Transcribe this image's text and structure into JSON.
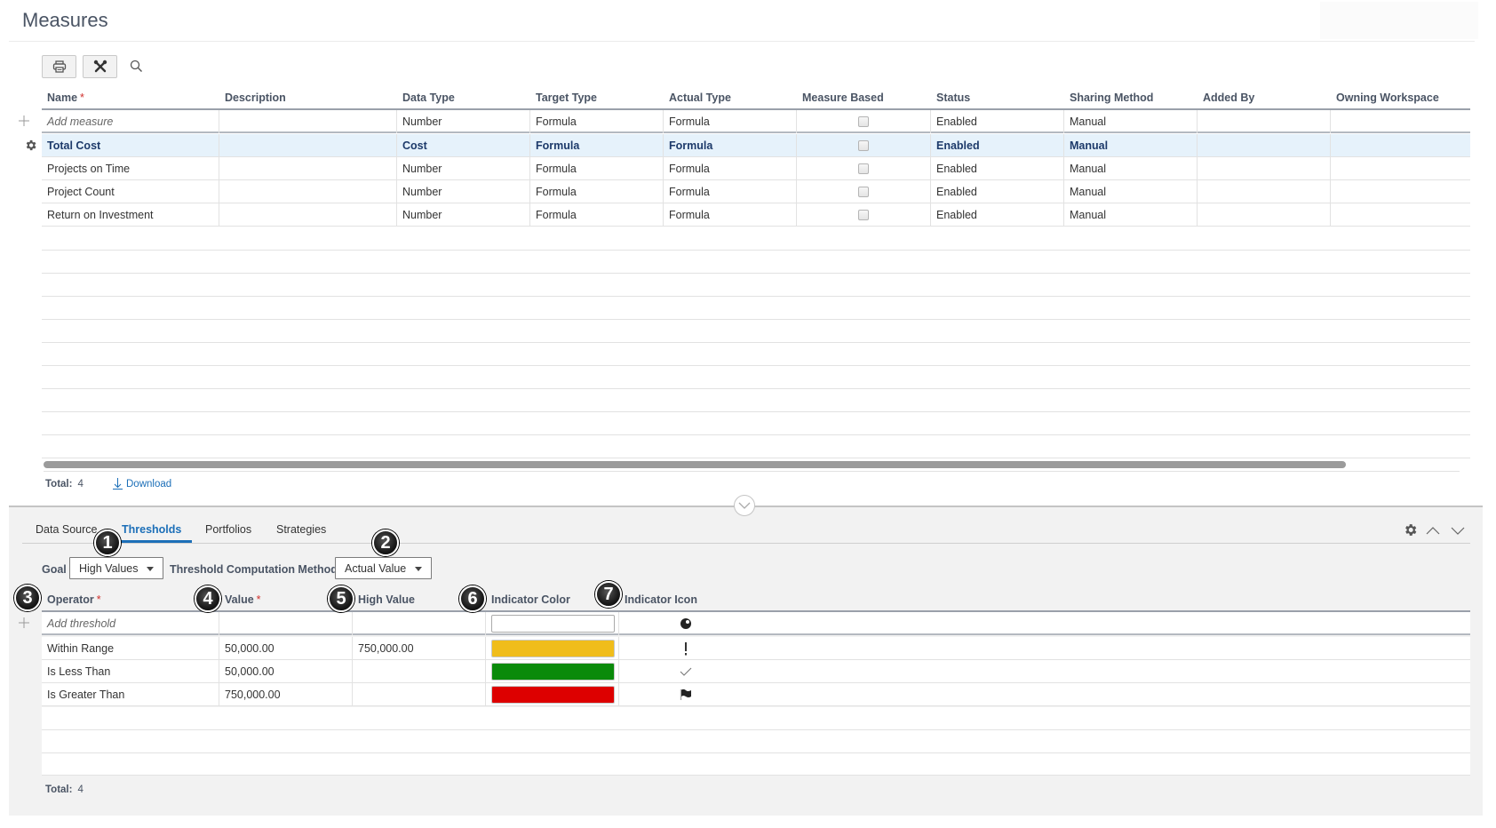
{
  "page": {
    "title": "Measures"
  },
  "toolbar": {
    "print_icon": "printer-icon",
    "tools_icon": "tools-icon",
    "search_icon": "search-icon"
  },
  "measures_grid": {
    "columns": [
      {
        "label": "Name",
        "required": true
      },
      {
        "label": "Description",
        "required": false
      },
      {
        "label": "Data Type",
        "required": false
      },
      {
        "label": "Target Type",
        "required": false
      },
      {
        "label": "Actual Type",
        "required": false
      },
      {
        "label": "Measure Based",
        "required": false
      },
      {
        "label": "Status",
        "required": false
      },
      {
        "label": "Sharing Method",
        "required": false
      },
      {
        "label": "Added By",
        "required": false
      },
      {
        "label": "Owning Workspace",
        "required": false
      }
    ],
    "add_row": {
      "placeholder": "Add measure",
      "data_type": "Number",
      "target_type": "Formula",
      "actual_type": "Formula",
      "measure_based": false,
      "status": "Enabled",
      "sharing_method": "Manual"
    },
    "rows": [
      {
        "name": "Total Cost",
        "description": "",
        "data_type": "Cost",
        "target_type": "Formula",
        "actual_type": "Formula",
        "measure_based": false,
        "status": "Enabled",
        "sharing_method": "Manual",
        "added_by": "",
        "owning_workspace": "",
        "selected": true
      },
      {
        "name": "Projects on Time",
        "description": "",
        "data_type": "Number",
        "target_type": "Formula",
        "actual_type": "Formula",
        "measure_based": false,
        "status": "Enabled",
        "sharing_method": "Manual",
        "added_by": "",
        "owning_workspace": "",
        "selected": false
      },
      {
        "name": "Project Count",
        "description": "",
        "data_type": "Number",
        "target_type": "Formula",
        "actual_type": "Formula",
        "measure_based": false,
        "status": "Enabled",
        "sharing_method": "Manual",
        "added_by": "",
        "owning_workspace": "",
        "selected": false
      },
      {
        "name": "Return on Investment",
        "description": "",
        "data_type": "Number",
        "target_type": "Formula",
        "actual_type": "Formula",
        "measure_based": false,
        "status": "Enabled",
        "sharing_method": "Manual",
        "added_by": "",
        "owning_workspace": "",
        "selected": false
      }
    ],
    "footer": {
      "total_label": "Total:",
      "total_value": "4",
      "download_label": "Download"
    },
    "horizontal_scroll_visible_fraction": 0.94
  },
  "detail_panel": {
    "tabs": [
      {
        "label": "Data Source",
        "active": false
      },
      {
        "label": "Thresholds",
        "active": true
      },
      {
        "label": "Portfolios",
        "active": false
      },
      {
        "label": "Strategies",
        "active": false
      }
    ],
    "goal": {
      "label": "Goal",
      "value": "High Values"
    },
    "computation_method": {
      "label": "Threshold Computation Method",
      "value": "Actual Value"
    },
    "thresholds_grid": {
      "columns": [
        {
          "label": "Operator",
          "required": true
        },
        {
          "label": "Value",
          "required": true
        },
        {
          "label": "High Value",
          "required": false
        },
        {
          "label": "Indicator Color",
          "required": false
        },
        {
          "label": "Indicator Icon",
          "required": false
        }
      ],
      "add_row": {
        "placeholder": "Add threshold",
        "color": "#ffffff",
        "icon": "circle-dot-icon"
      },
      "rows": [
        {
          "operator": "Within Range",
          "value": "50,000.00",
          "high_value": "750,000.00",
          "color": "#f0bd1b",
          "icon": "exclamation-icon",
          "icon_glyph": "!"
        },
        {
          "operator": "Is Less Than",
          "value": "50,000.00",
          "high_value": "",
          "color": "#0a8a0a",
          "icon": "checkmark-icon",
          "icon_glyph": "✓"
        },
        {
          "operator": "Is Greater Than",
          "value": "750,000.00",
          "high_value": "",
          "color": "#dd0000",
          "icon": "flag-icon",
          "icon_glyph": "⚑"
        }
      ],
      "footer": {
        "total_label": "Total:",
        "total_value": "4"
      }
    },
    "callouts": [
      "1",
      "2",
      "3",
      "4",
      "5",
      "6",
      "7"
    ]
  }
}
